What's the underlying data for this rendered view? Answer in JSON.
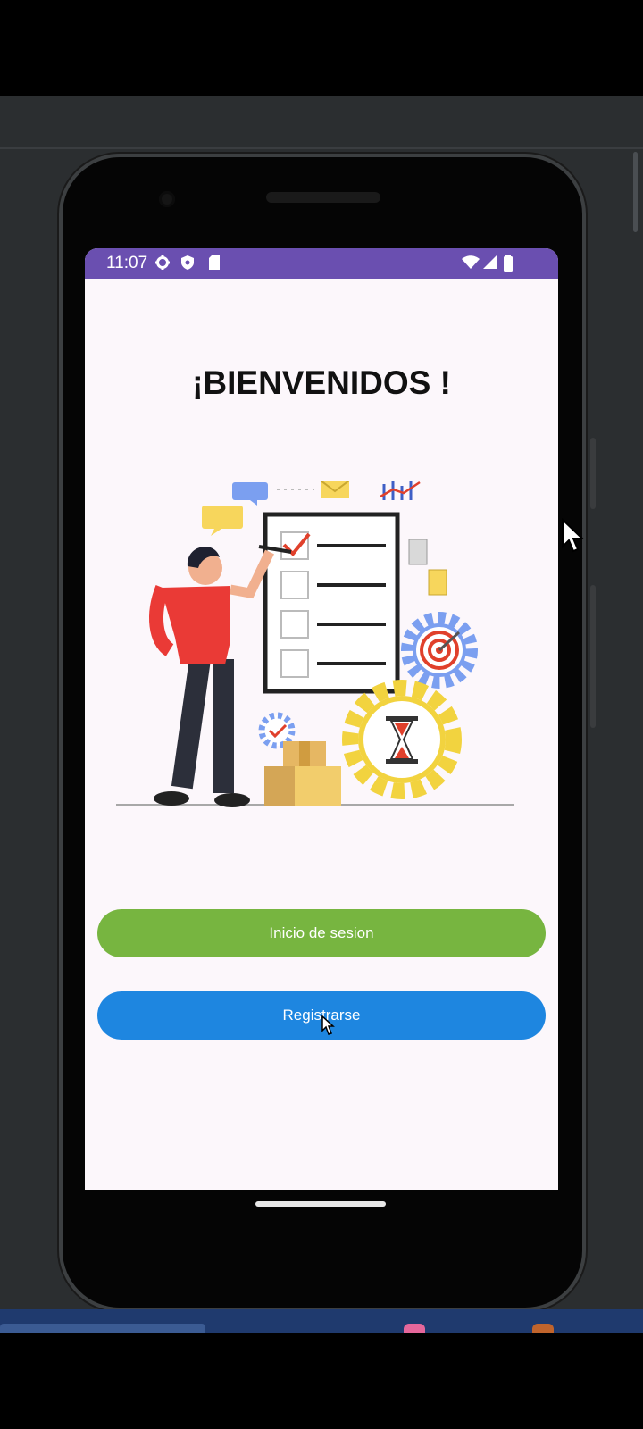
{
  "status_bar": {
    "time": "11:07",
    "icons_left": [
      "gear-icon",
      "shield-icon",
      "sim-card-icon"
    ],
    "icons_right": [
      "wifi-icon",
      "signal-icon",
      "battery-icon"
    ],
    "color": "#6a4fb0"
  },
  "welcome": {
    "title": "¡BIENVENIDOS !"
  },
  "illustration": {
    "description_icons": [
      "checklist-icon",
      "person-icon",
      "hourglass-gear-icon",
      "target-gear-icon",
      "email-icon",
      "chat-bubble-icon",
      "boxes-icon",
      "chart-icon"
    ]
  },
  "buttons": {
    "login_label": "Inicio de sesion",
    "login_color": "#77b540",
    "register_label": "Registrarse",
    "register_color": "#1e86e0"
  }
}
